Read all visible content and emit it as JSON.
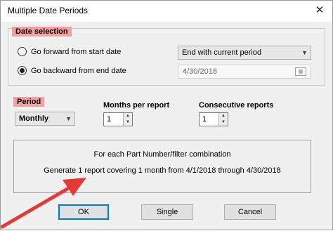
{
  "window": {
    "title": "Multiple Date Periods",
    "close_glyph": "✕"
  },
  "date_selection": {
    "group_label": "Date selection",
    "option_forward": "Go forward from start date",
    "option_backward": "Go backward from end date",
    "selected_option": "backward",
    "forward_combo_value": "End with current period",
    "end_date_value": "4/30/2018"
  },
  "period": {
    "label": "Period",
    "value": "Monthly",
    "months_label": "Months per report",
    "months_value": "1",
    "consecutive_label": "Consecutive reports",
    "consecutive_value": "1"
  },
  "summary": {
    "line1": "For each Part Number/filter combination",
    "line2": "Generate 1 report covering 1 month from 4/1/2018 through 4/30/2018"
  },
  "buttons": {
    "ok": "OK",
    "single": "Single",
    "cancel": "Cancel"
  },
  "icons": {
    "dropdown": "chevron-down-icon",
    "calendar": "calendar-icon",
    "spin_up": "▲",
    "spin_down": "▼"
  },
  "colors": {
    "highlight": "#f3a0a0",
    "annotation_arrow": "#e53935",
    "default_button_border": "#0078d7"
  }
}
